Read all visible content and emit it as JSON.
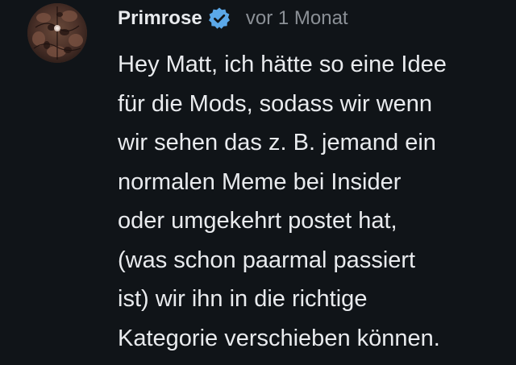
{
  "comment": {
    "author": "Primrose",
    "verified_icon": "verified-badge-icon",
    "verified_color": "#5ba8e8",
    "timestamp": "vor 1 Monat",
    "text": "Hey Matt, ich hätte so eine Idee\nfür die Mods, sodass wir wenn\nwir sehen das z. B. jemand ein\nnormalen Meme bei Insider\noder umgekehrt postet hat,\n(was schon paarmal passiert\nist) wir ihn in die richtige\nKategorie verschieben können."
  }
}
